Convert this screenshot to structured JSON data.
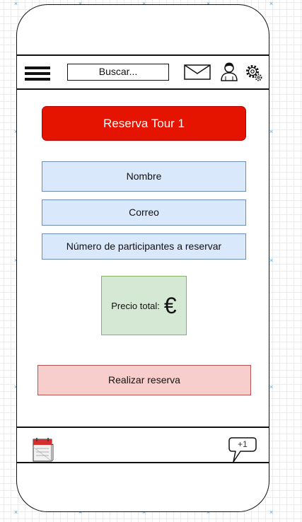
{
  "header": {
    "search_placeholder": "Buscar...",
    "icons": [
      "menu-icon",
      "mail-icon",
      "user-icon",
      "settings-icon"
    ]
  },
  "main": {
    "title_button": "Reserva Tour 1",
    "fields": [
      {
        "label": "Nombre"
      },
      {
        "label": "Correo"
      },
      {
        "label": "Número de participantes a reservar"
      }
    ],
    "price": {
      "label": "Precio total:",
      "currency_symbol": "€"
    },
    "submit_button": "Realizar reserva"
  },
  "footer": {
    "icons": [
      "calendar-icon",
      "chat-bubble-icon"
    ],
    "notification_badge": "+1"
  },
  "colors": {
    "title_button_bg": "#e51400",
    "field_bg": "#dae8fc",
    "field_border": "#6c8ebf",
    "price_bg": "#d5e8d4",
    "price_border": "#82b366",
    "submit_bg": "#f8cecc",
    "submit_border": "#b85450"
  }
}
